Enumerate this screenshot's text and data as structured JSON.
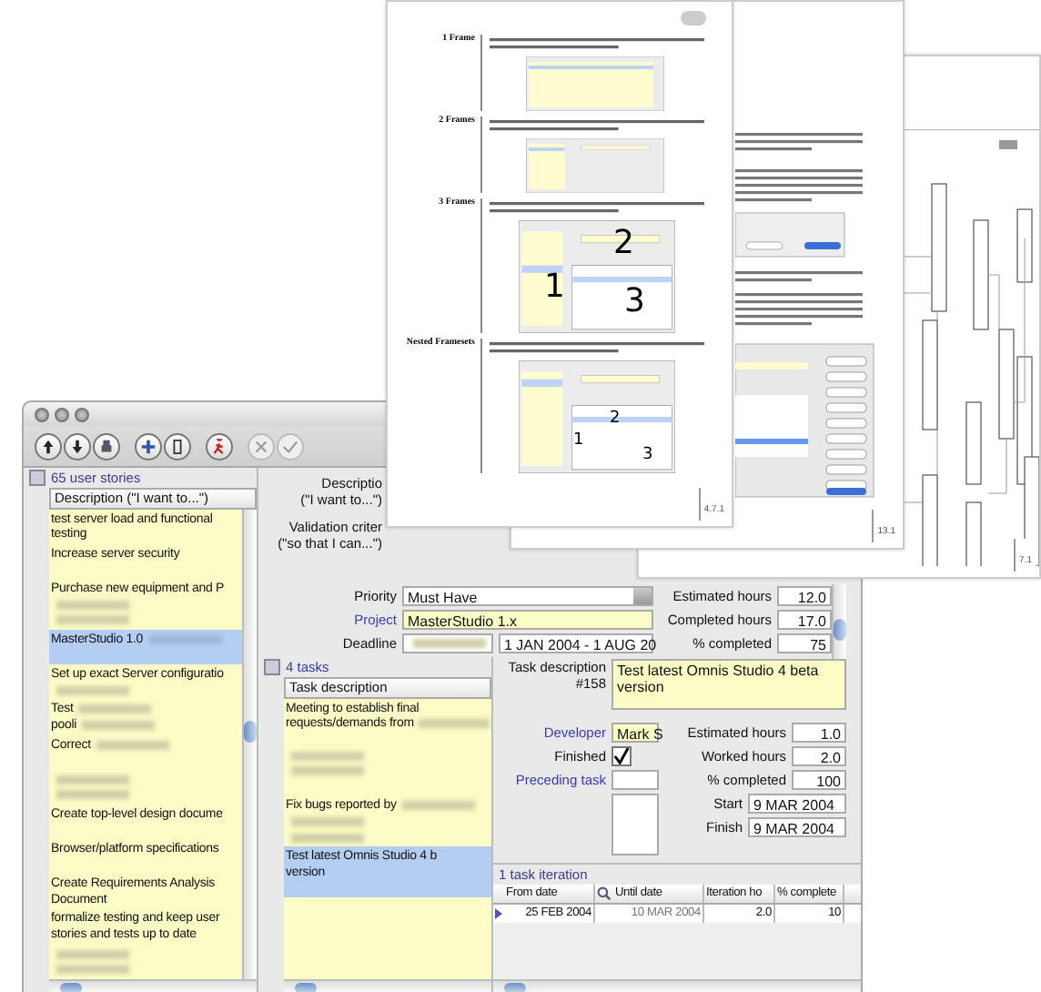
{
  "pages": [
    {
      "kind": "uml",
      "number": "7.1"
    },
    {
      "kind": "article",
      "number": "13.1"
    },
    {
      "kind": "framesets",
      "number": "4.7.1",
      "sections": [
        {
          "heading": "1 Frame"
        },
        {
          "heading": "2 Frames"
        },
        {
          "heading": "3 Frames",
          "callouts": [
            "1",
            "2",
            "3"
          ]
        },
        {
          "heading": "Nested Framesets",
          "callouts": [
            "1",
            "2",
            "3"
          ]
        }
      ]
    }
  ],
  "toolbar": [
    {
      "kind": "up",
      "disabled": false
    },
    {
      "kind": "down",
      "disabled": false
    },
    {
      "kind": "print",
      "disabled": false
    },
    {
      "kind": "add",
      "disabled": false
    },
    {
      "kind": "page",
      "disabled": false
    },
    {
      "kind": "run",
      "disabled": false
    },
    {
      "kind": "cancel",
      "disabled": true
    },
    {
      "kind": "confirm",
      "disabled": true
    }
  ],
  "stories": {
    "count_label": "65 user stories",
    "column": "Description (\"I want to...\")",
    "rows": [
      {
        "selected": false,
        "lines": [
          {
            "text": "test server load and functional"
          },
          {
            "text": "testing"
          }
        ]
      },
      {
        "selected": false,
        "lines": [
          {
            "text": "Increase server security"
          },
          {
            "blur": false
          }
        ]
      },
      {
        "selected": false,
        "lines": [
          {
            "text": "Purchase new equipment and P"
          },
          {
            "blur": true
          },
          {
            "blur": true
          }
        ]
      },
      {
        "selected": true,
        "lines": [
          {
            "text": "MasterStudio 1.0",
            "blur": true
          },
          {
            "blur": false
          }
        ]
      },
      {
        "selected": false,
        "lines": [
          {
            "text": "Set up exact Server configuratio"
          },
          {
            "blur": true
          }
        ]
      },
      {
        "selected": false,
        "lines": [
          {
            "text": "Test",
            "blur": true
          },
          {
            "text": "pooli",
            "blur": true
          }
        ]
      },
      {
        "selected": false,
        "lines": [
          {
            "text": "Correct",
            "blur": true
          },
          {
            "blur": false
          }
        ]
      },
      {
        "selected": false,
        "lines": [
          {
            "blur": true
          },
          {
            "blur": true
          }
        ]
      },
      {
        "selected": false,
        "lines": [
          {
            "text": "Create top-level design docume"
          },
          {
            "blur": false
          }
        ]
      },
      {
        "selected": false,
        "lines": [
          {
            "text": "Browser/platform specifications"
          },
          {
            "blur": false
          }
        ]
      },
      {
        "selected": false,
        "lines": [
          {
            "text": "Create Requirements Analysis"
          },
          {
            "text": "Document"
          }
        ]
      },
      {
        "selected": false,
        "lines": [
          {
            "text": "formalize testing and keep user"
          },
          {
            "text": "stories and tests up to date"
          }
        ]
      },
      {
        "selected": false,
        "lines": [
          {
            "blur": true
          },
          {
            "blur": true
          }
        ]
      }
    ]
  },
  "story_form": {
    "description_label": "Descriptio",
    "description_hint": "(\"I want to...\")",
    "validation_label": "Validation criter",
    "validation_hint": "(\"so that I can...\")",
    "priority": {
      "label": "Priority",
      "value": "Must Have"
    },
    "project": {
      "label": "Project",
      "value": "MasterStudio 1.x"
    },
    "deadline": {
      "label": "Deadline",
      "value": "1 JAN 2004 - 1 AUG 20"
    },
    "hours": [
      {
        "label": "Estimated hours",
        "value": "12.0"
      },
      {
        "label": "Completed hours",
        "value": "17.0"
      },
      {
        "label": "% completed",
        "value": "75"
      }
    ]
  },
  "tasks": {
    "count_label": "4 tasks",
    "column": "Task description",
    "rows": [
      {
        "selected": false,
        "lines": [
          {
            "text": "Meeting to establish final"
          },
          {
            "text": "requests/demands from",
            "blur": true
          },
          {
            "blur": false
          },
          {
            "blur": true
          },
          {
            "blur": true
          },
          {
            "blur": false
          }
        ]
      },
      {
        "selected": false,
        "lines": [
          {
            "text": "Fix bugs reported by",
            "blur": true
          },
          {
            "blur": true
          },
          {
            "blur": true
          }
        ]
      },
      {
        "selected": true,
        "lines": [
          {
            "text": "Test latest Omnis Studio 4 b"
          },
          {
            "text": "version"
          },
          {
            "blur": false
          }
        ]
      }
    ]
  },
  "task": {
    "label": "Task description",
    "number": "#158",
    "value": "Test latest Omnis Studio 4 beta version",
    "developer": {
      "label": "Developer",
      "value": "Mark S"
    },
    "finished": {
      "label": "Finished",
      "checked": true
    },
    "preceding": {
      "label": "Preceding task"
    },
    "hours": [
      {
        "label": "Estimated hours",
        "value": "1.0"
      },
      {
        "label": "Worked hours",
        "value": "2.0"
      },
      {
        "label": "% completed",
        "value": "100"
      }
    ],
    "start": {
      "label": "Start",
      "value": "9 MAR 2004"
    },
    "finish": {
      "label": "Finish",
      "value": "9 MAR 2004"
    }
  },
  "iterations": {
    "count_label": "1 task iteration",
    "columns": [
      "From date",
      "Until date",
      "Iteration ho",
      "% complete"
    ],
    "rows": [
      {
        "current": true,
        "cells": [
          "25 FEB 2004",
          "10 MAR 2004",
          "2.0",
          "10"
        ]
      }
    ]
  }
}
